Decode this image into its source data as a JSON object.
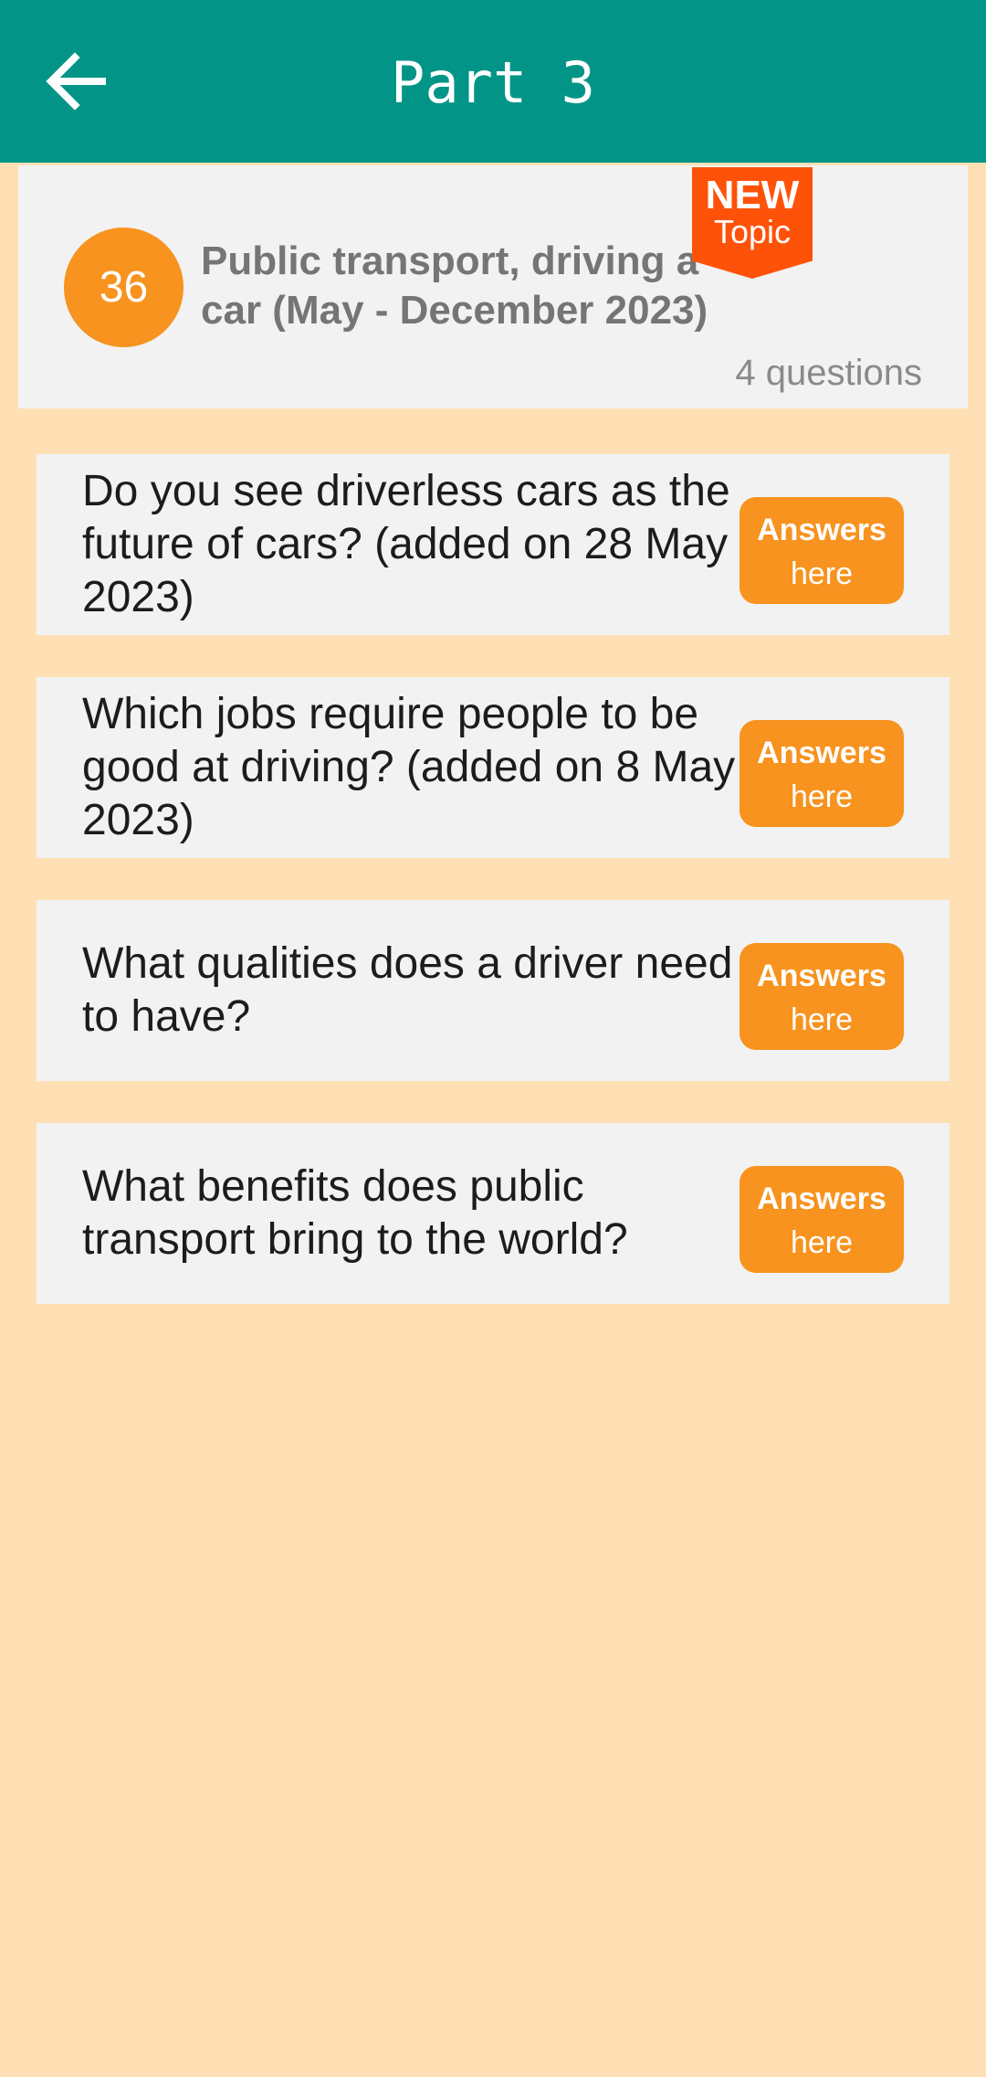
{
  "app_bar": {
    "title": "Part 3",
    "back_icon": "arrow-left-icon",
    "color": "#029587"
  },
  "topic": {
    "number": "36",
    "title": "Public transport, driving a car (May - December 2023)",
    "question_count": "4 questions",
    "badge": {
      "line1": "NEW",
      "line2": "Topic",
      "color": "#FF5209"
    },
    "accent_color": "#F7931E"
  },
  "questions": [
    {
      "text": "Do you see driverless cars as the future of cars? (added on 28 May 2023)",
      "button_line1": "Answers",
      "button_line2": "here"
    },
    {
      "text": "Which jobs require people to be good at driving? (added on 8 May 2023)",
      "button_line1": "Answers",
      "button_line2": "here"
    },
    {
      "text": "What qualities does a driver need to have?",
      "button_line1": "Answers",
      "button_line2": "here"
    },
    {
      "text": "What benefits does public transport bring to the world?",
      "button_line1": "Answers",
      "button_line2": "here"
    }
  ],
  "colors": {
    "background": "#FFE0B5",
    "card": "#F2F2F2"
  }
}
